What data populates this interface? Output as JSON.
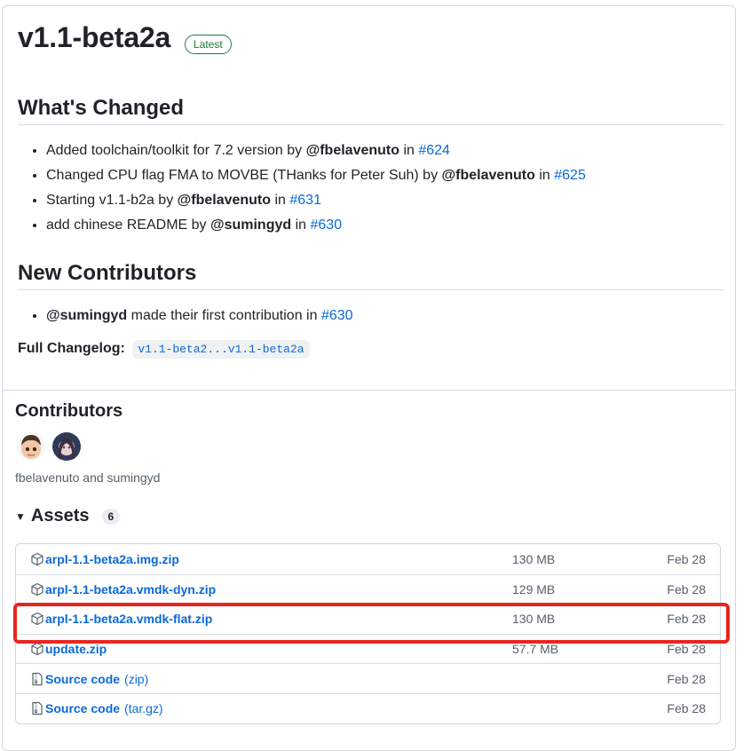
{
  "release": {
    "title": "v1.1-beta2a",
    "badge": "Latest"
  },
  "whats_changed": {
    "heading": "What's Changed",
    "items": [
      {
        "pre": "Added toolchain/toolkit for 7.2 version by ",
        "user": "@fbelavenuto",
        "mid": " in ",
        "pr": "#624"
      },
      {
        "pre": "Changed CPU flag FMA to MOVBE (THanks for Peter Suh) by ",
        "user": "@fbelavenuto",
        "mid": " in ",
        "pr": "#625"
      },
      {
        "pre": "Starting v1.1-b2a by ",
        "user": "@fbelavenuto",
        "mid": " in ",
        "pr": "#631"
      },
      {
        "pre": "add chinese README by ",
        "user": "@sumingyd",
        "mid": " in ",
        "pr": "#630"
      }
    ]
  },
  "new_contributors": {
    "heading": "New Contributors",
    "items": [
      {
        "user": "@sumingyd",
        "mid": " made their first contribution in ",
        "pr": "#630"
      }
    ]
  },
  "changelog": {
    "label": "Full Changelog",
    "colon": ":",
    "compare": "v1.1-beta2...v1.1-beta2a"
  },
  "contributors": {
    "heading": "Contributors",
    "names": "fbelavenuto and sumingyd",
    "avatars": [
      "avatar-fbelavenuto",
      "avatar-sumingyd"
    ]
  },
  "assets": {
    "heading": "Assets",
    "count": "6",
    "items": [
      {
        "icon": "package-icon",
        "name": "arpl-1.1-beta2a.img.zip",
        "extra": "",
        "size": "130 MB",
        "date": "Feb 28"
      },
      {
        "icon": "package-icon",
        "name": "arpl-1.1-beta2a.vmdk-dyn.zip",
        "extra": "",
        "size": "129 MB",
        "date": "Feb 28"
      },
      {
        "icon": "package-icon",
        "name": "arpl-1.1-beta2a.vmdk-flat.zip",
        "extra": "",
        "size": "130 MB",
        "date": "Feb 28",
        "highlighted": true
      },
      {
        "icon": "package-icon",
        "name": "update.zip",
        "extra": "",
        "size": "57.7 MB",
        "date": "Feb 28"
      },
      {
        "icon": "file-zip-icon",
        "name": "Source code",
        "extra": "(zip)",
        "size": "",
        "date": "Feb 28"
      },
      {
        "icon": "file-zip-icon",
        "name": "Source code",
        "extra": "(tar.gz)",
        "size": "",
        "date": "Feb 28"
      }
    ]
  },
  "colors": {
    "link": "#0969da",
    "latest": "#1a7f37",
    "highlight": "#e8261e"
  }
}
